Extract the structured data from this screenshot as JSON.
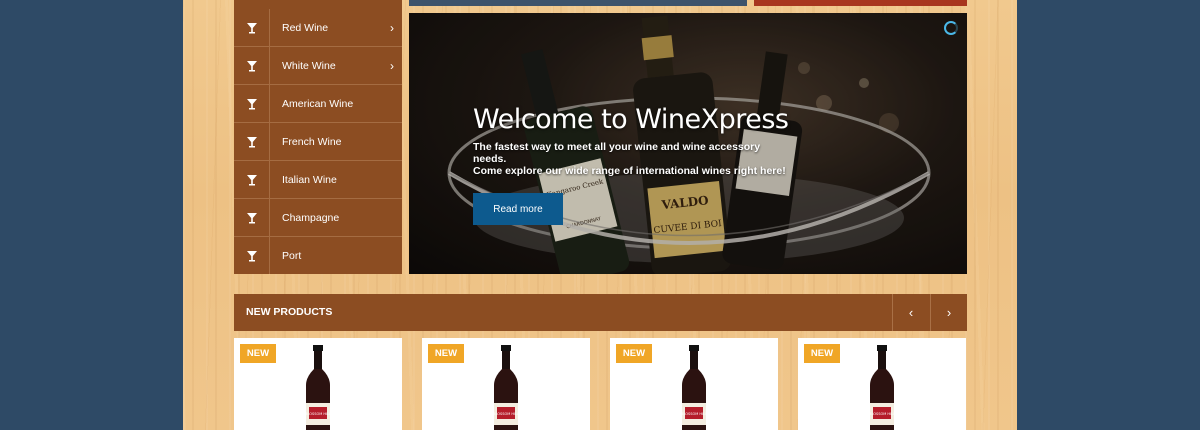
{
  "categories": [
    {
      "label": "Red Wine",
      "has_submenu": true
    },
    {
      "label": "White Wine",
      "has_submenu": true
    },
    {
      "label": "American Wine",
      "has_submenu": false
    },
    {
      "label": "French Wine",
      "has_submenu": false
    },
    {
      "label": "Italian Wine",
      "has_submenu": false
    },
    {
      "label": "Champagne",
      "has_submenu": false
    },
    {
      "label": "Port",
      "has_submenu": false
    }
  ],
  "hero": {
    "title": "Welcome to WineXpress",
    "subtitle_line1": "The fastest way to meet all your wine and wine accessory needs.",
    "subtitle_line2": "Come explore our wide range of international wines right here!",
    "button_label": "Read more",
    "bottle_label_1": "VALDO",
    "bottle_label_2": "CUVEE DI BOI",
    "bottle_label_3": "Kangaroo Creek",
    "bottle_label_4": "CHARDONNAY"
  },
  "new_products": {
    "title": "NEW PRODUCTS",
    "prev_icon": "chevron-left-icon",
    "next_icon": "chevron-right-icon",
    "cards": [
      {
        "badge": "NEW",
        "label": "BLOSSOM HILL"
      },
      {
        "badge": "NEW",
        "label": "BLOSSOM HILL"
      },
      {
        "badge": "NEW",
        "label": "BLOSSOM HILL"
      },
      {
        "badge": "NEW",
        "label": "BLOSSOM HILL"
      }
    ]
  },
  "colors": {
    "background": "#2e4a66",
    "sidebar": "#8c4d22",
    "accent_blue": "#0d5a8e",
    "badge": "#f0a626"
  }
}
